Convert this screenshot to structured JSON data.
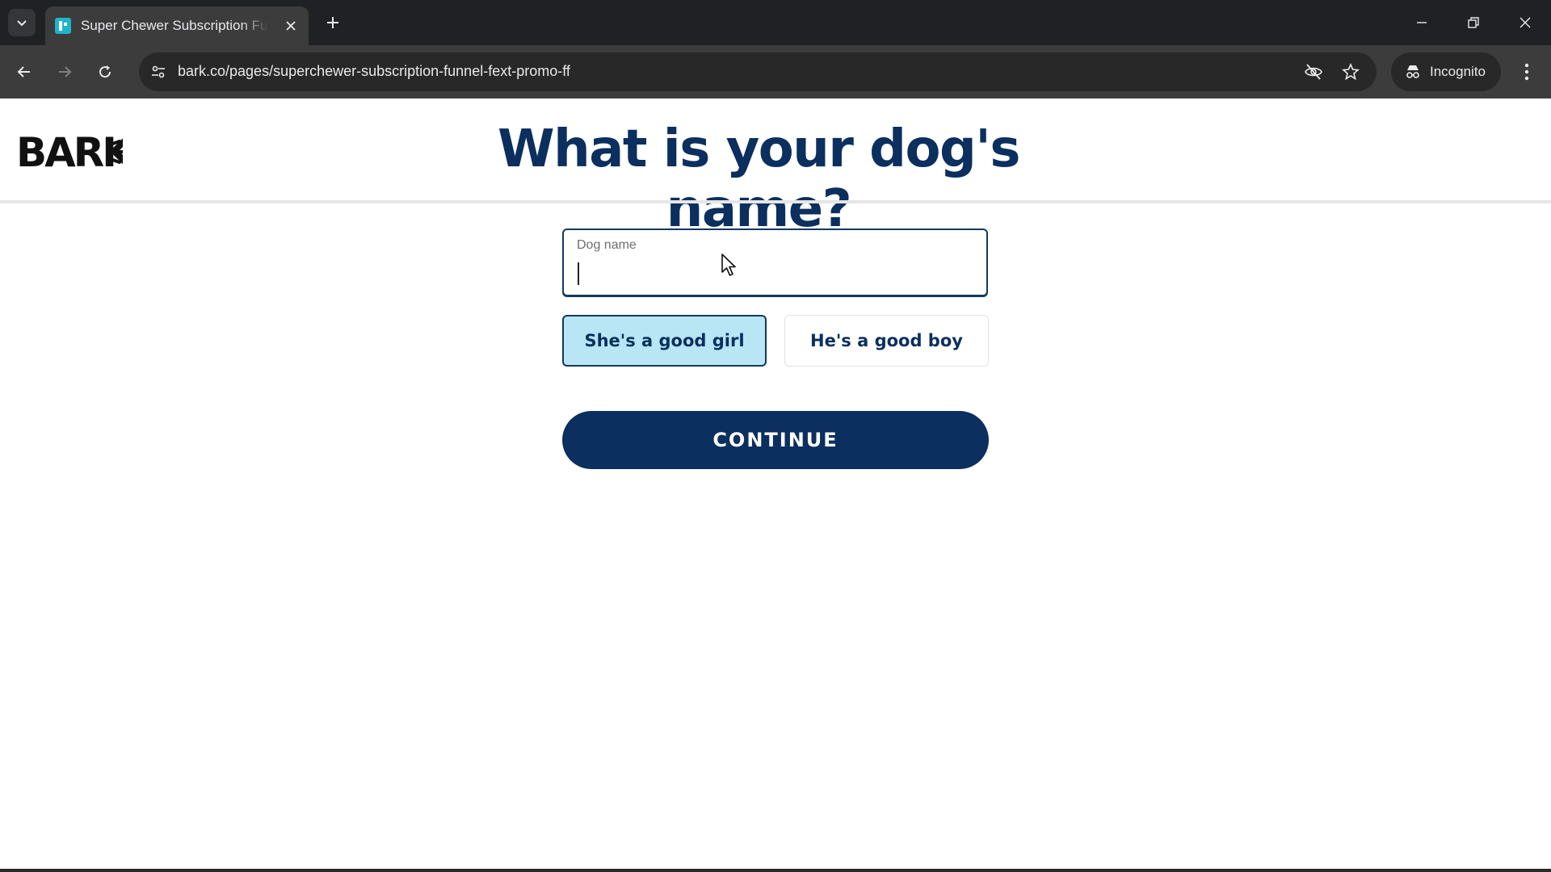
{
  "browser": {
    "tab": {
      "title": "Super Chewer Subscription Funnel"
    },
    "address_bar": {
      "url": "bark.co/pages/superchewer-subscription-funnel-fext-promo-ff"
    },
    "profile": {
      "label": "Incognito"
    }
  },
  "page": {
    "logo_text": "BARK",
    "question": "What is your dog's name?",
    "dog_name_field": {
      "label": "Dog name",
      "value": ""
    },
    "gender_options": [
      {
        "label": "She's a good girl",
        "selected": true
      },
      {
        "label": "He's a good boy",
        "selected": false
      }
    ],
    "continue_label": "CONTINUE"
  },
  "colors": {
    "brand_navy": "#0b2f5e",
    "selected_option_bg": "#b8e6f4",
    "chrome_dark": "#202124"
  }
}
